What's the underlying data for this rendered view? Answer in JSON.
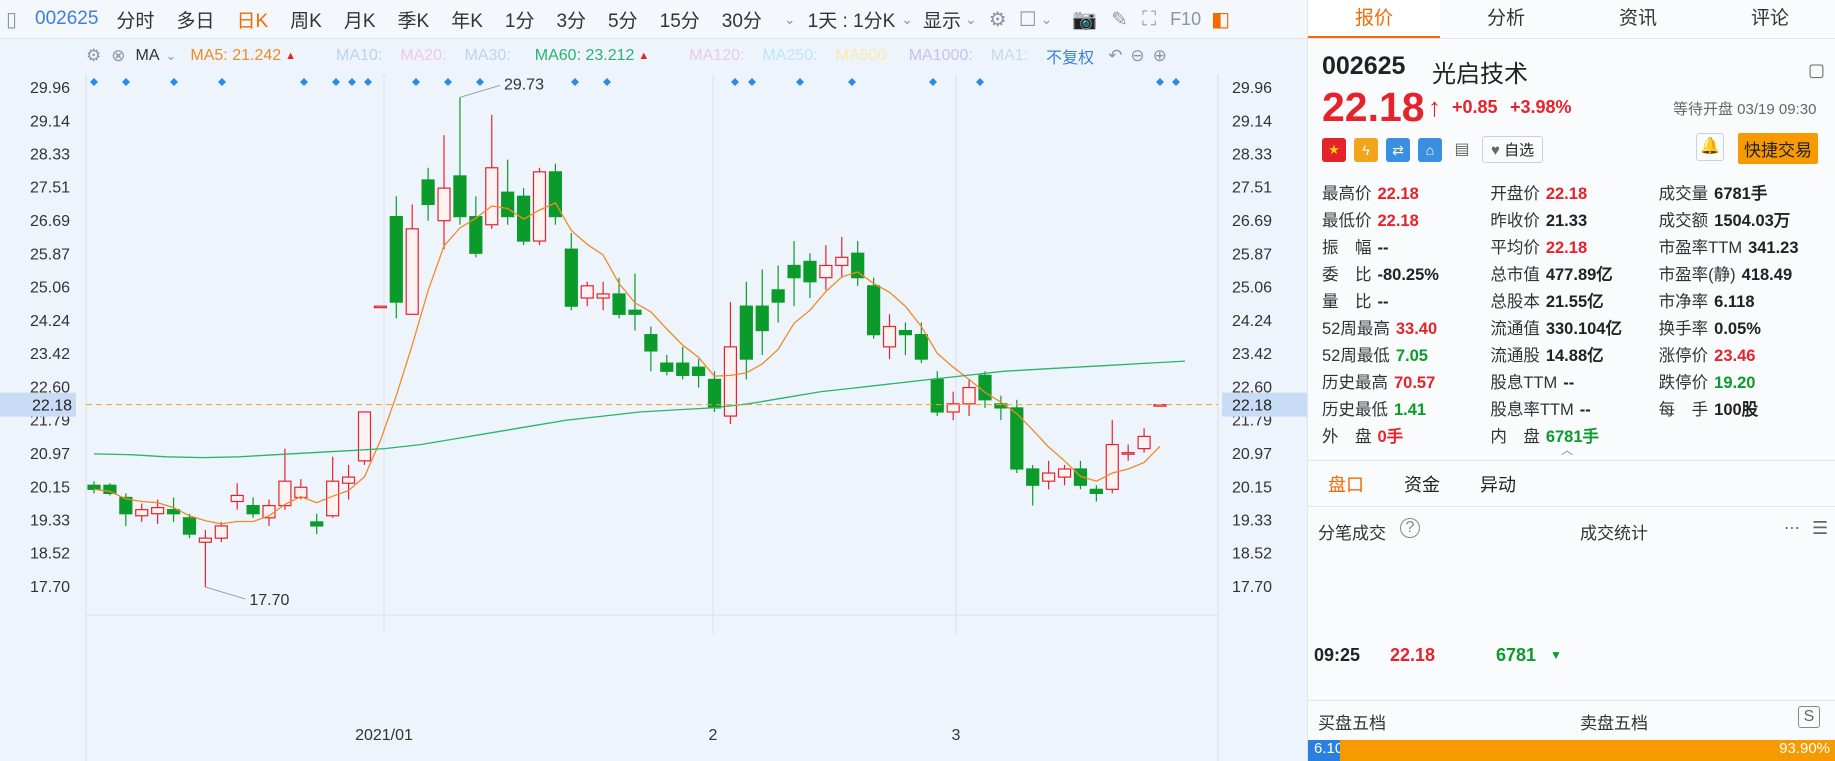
{
  "toolbar": {
    "code": "002625",
    "items": [
      "分时",
      "多日",
      "日K",
      "周K",
      "月K",
      "季K",
      "年K",
      "1分",
      "3分",
      "5分",
      "15分",
      "30分"
    ],
    "active": "日K",
    "range": "1天 : 1分K",
    "display": "显示"
  },
  "ma_bar": {
    "ma_label": "MA",
    "ma5": "MA5: 21.242",
    "ma10": "MA10:",
    "ma20": "MA20:",
    "ma30": "MA30:",
    "ma60": "MA60: 23.212",
    "ma120": "MA120:",
    "ma250": "MA250:",
    "ma500": "MA500:",
    "ma1000": "MA1000:",
    "ma1": "MA1:",
    "adjust": "不复权"
  },
  "chart": {
    "high_label": "29.73",
    "low_label": "17.70",
    "current_price_tag": "22.18",
    "x_labels": [
      "2021/01",
      "2",
      "3"
    ],
    "y_ticks": [
      "29.96",
      "29.14",
      "28.33",
      "27.51",
      "26.69",
      "25.87",
      "25.06",
      "24.24",
      "23.42",
      "22.60",
      "21.79",
      "20.97",
      "20.15",
      "19.33",
      "18.52",
      "17.70"
    ]
  },
  "chart_data": {
    "type": "bar",
    "title": "",
    "ylim": [
      17.7,
      29.96
    ],
    "candles": [
      {
        "o": 20.2,
        "c": 20.1,
        "h": 20.3,
        "l": 20.0
      },
      {
        "o": 20.2,
        "c": 20.0,
        "h": 20.25,
        "l": 19.95
      },
      {
        "o": 19.9,
        "c": 19.5,
        "h": 20.0,
        "l": 19.2
      },
      {
        "o": 19.45,
        "c": 19.6,
        "h": 19.75,
        "l": 19.3
      },
      {
        "o": 19.5,
        "c": 19.65,
        "h": 19.85,
        "l": 19.25
      },
      {
        "o": 19.6,
        "c": 19.5,
        "h": 19.9,
        "l": 19.3
      },
      {
        "o": 19.4,
        "c": 19.0,
        "h": 19.5,
        "l": 18.9
      },
      {
        "o": 18.8,
        "c": 18.9,
        "h": 19.1,
        "l": 17.7
      },
      {
        "o": 18.9,
        "c": 19.2,
        "h": 19.3,
        "l": 18.8
      },
      {
        "o": 19.8,
        "c": 19.95,
        "h": 20.25,
        "l": 19.6
      },
      {
        "o": 19.7,
        "c": 19.5,
        "h": 19.9,
        "l": 19.4
      },
      {
        "o": 19.4,
        "c": 19.7,
        "h": 19.85,
        "l": 19.2
      },
      {
        "o": 19.7,
        "c": 20.3,
        "h": 21.1,
        "l": 19.6
      },
      {
        "o": 19.9,
        "c": 20.15,
        "h": 20.35,
        "l": 19.85
      },
      {
        "o": 19.3,
        "c": 19.2,
        "h": 19.5,
        "l": 19.0
      },
      {
        "o": 19.45,
        "c": 20.3,
        "h": 20.9,
        "l": 19.4
      },
      {
        "o": 20.25,
        "c": 20.4,
        "h": 20.7,
        "l": 19.85
      },
      {
        "o": 20.8,
        "c": 22.0,
        "h": 22.0,
        "l": 20.7
      },
      {
        "o": 24.6,
        "c": 24.6,
        "h": 24.6,
        "l": 24.6
      },
      {
        "o": 26.8,
        "c": 24.7,
        "h": 27.3,
        "l": 24.3
      },
      {
        "o": 24.4,
        "c": 26.5,
        "h": 27.1,
        "l": 24.4
      },
      {
        "o": 27.7,
        "c": 27.1,
        "h": 28.0,
        "l": 26.7
      },
      {
        "o": 26.7,
        "c": 27.5,
        "h": 28.8,
        "l": 26.0
      },
      {
        "o": 27.8,
        "c": 26.8,
        "h": 29.73,
        "l": 26.6
      },
      {
        "o": 26.8,
        "c": 25.9,
        "h": 27.3,
        "l": 25.8
      },
      {
        "o": 26.6,
        "c": 28.0,
        "h": 29.3,
        "l": 26.5
      },
      {
        "o": 27.4,
        "c": 26.8,
        "h": 28.2,
        "l": 26.6
      },
      {
        "o": 27.3,
        "c": 26.2,
        "h": 27.5,
        "l": 26.1
      },
      {
        "o": 26.2,
        "c": 27.9,
        "h": 28.0,
        "l": 26.1
      },
      {
        "o": 27.9,
        "c": 26.8,
        "h": 28.1,
        "l": 26.6
      },
      {
        "o": 26.0,
        "c": 24.6,
        "h": 26.4,
        "l": 24.5
      },
      {
        "o": 24.8,
        "c": 25.1,
        "h": 25.2,
        "l": 24.6
      },
      {
        "o": 24.8,
        "c": 24.9,
        "h": 25.2,
        "l": 24.5
      },
      {
        "o": 24.9,
        "c": 24.4,
        "h": 25.3,
        "l": 24.3
      },
      {
        "o": 24.5,
        "c": 24.4,
        "h": 25.4,
        "l": 24.0
      },
      {
        "o": 23.9,
        "c": 23.5,
        "h": 24.1,
        "l": 23.0
      },
      {
        "o": 23.2,
        "c": 23.0,
        "h": 23.4,
        "l": 22.9
      },
      {
        "o": 23.2,
        "c": 22.9,
        "h": 23.6,
        "l": 22.8
      },
      {
        "o": 23.1,
        "c": 22.9,
        "h": 23.3,
        "l": 22.6
      },
      {
        "o": 22.8,
        "c": 22.1,
        "h": 23.0,
        "l": 22.0
      },
      {
        "o": 21.9,
        "c": 23.6,
        "h": 24.7,
        "l": 21.7
      },
      {
        "o": 24.6,
        "c": 23.3,
        "h": 25.2,
        "l": 22.8
      },
      {
        "o": 24.6,
        "c": 24.0,
        "h": 25.5,
        "l": 23.4
      },
      {
        "o": 25.0,
        "c": 24.7,
        "h": 25.6,
        "l": 24.2
      },
      {
        "o": 25.6,
        "c": 25.3,
        "h": 26.2,
        "l": 24.6
      },
      {
        "o": 25.7,
        "c": 25.2,
        "h": 25.9,
        "l": 24.8
      },
      {
        "o": 25.3,
        "c": 25.6,
        "h": 26.1,
        "l": 25.0
      },
      {
        "o": 25.6,
        "c": 25.8,
        "h": 26.3,
        "l": 25.3
      },
      {
        "o": 25.9,
        "c": 25.3,
        "h": 26.2,
        "l": 25.1
      },
      {
        "o": 25.1,
        "c": 23.9,
        "h": 25.3,
        "l": 23.8
      },
      {
        "o": 23.6,
        "c": 24.1,
        "h": 24.4,
        "l": 23.3
      },
      {
        "o": 24.0,
        "c": 23.9,
        "h": 24.2,
        "l": 23.4
      },
      {
        "o": 23.9,
        "c": 23.3,
        "h": 24.2,
        "l": 23.2
      },
      {
        "o": 22.8,
        "c": 22.0,
        "h": 23.0,
        "l": 21.9
      },
      {
        "o": 22.0,
        "c": 22.2,
        "h": 22.5,
        "l": 21.8
      },
      {
        "o": 22.2,
        "c": 22.6,
        "h": 22.8,
        "l": 21.9
      },
      {
        "o": 22.9,
        "c": 22.3,
        "h": 23.0,
        "l": 22.1
      },
      {
        "o": 22.2,
        "c": 22.1,
        "h": 22.4,
        "l": 21.8
      },
      {
        "o": 22.1,
        "c": 20.6,
        "h": 22.3,
        "l": 20.5
      },
      {
        "o": 20.6,
        "c": 20.2,
        "h": 20.7,
        "l": 19.7
      },
      {
        "o": 20.3,
        "c": 20.5,
        "h": 20.8,
        "l": 20.1
      },
      {
        "o": 20.4,
        "c": 20.6,
        "h": 20.7,
        "l": 20.2
      },
      {
        "o": 20.6,
        "c": 20.2,
        "h": 20.8,
        "l": 20.1
      },
      {
        "o": 20.1,
        "c": 20.0,
        "h": 20.2,
        "l": 19.8
      },
      {
        "o": 20.1,
        "c": 21.2,
        "h": 21.8,
        "l": 20.0
      },
      {
        "o": 21.0,
        "c": 21.0,
        "h": 21.2,
        "l": 20.8
      },
      {
        "o": 21.1,
        "c": 21.4,
        "h": 21.6,
        "l": 21.0
      },
      {
        "o": 22.18,
        "c": 22.18,
        "h": 22.18,
        "l": 22.18
      }
    ]
  },
  "stock": {
    "code": "002625",
    "name": "光启技术",
    "price": "22.18",
    "change": "+0.85",
    "pct": "+3.98%",
    "status": "等待开盘 03/19 09:30",
    "watchlist": "自选",
    "quick_trade": "快捷交易"
  },
  "quote_rows": [
    [
      [
        "最高价",
        "22.18",
        "red"
      ],
      [
        "开盘价",
        "22.18",
        "red"
      ],
      [
        "成交量",
        "6781手",
        ""
      ]
    ],
    [
      [
        "最低价",
        "22.18",
        "red"
      ],
      [
        "昨收价",
        "21.33",
        ""
      ],
      [
        "成交额",
        "1504.03万",
        ""
      ]
    ],
    [
      [
        "振　幅",
        "--",
        ""
      ],
      [
        "平均价",
        "22.18",
        "red"
      ],
      [
        "市盈率TTM",
        "341.23",
        ""
      ]
    ],
    [
      [
        "委　比",
        "-80.25%",
        ""
      ],
      [
        "总市值",
        "477.89亿",
        ""
      ],
      [
        "市盈率(静)",
        "418.49",
        ""
      ]
    ],
    [
      [
        "量　比",
        "--",
        ""
      ],
      [
        "总股本",
        "21.55亿",
        ""
      ],
      [
        "市净率",
        "6.118",
        ""
      ]
    ],
    [
      [
        "52周最高",
        "33.40",
        "red"
      ],
      [
        "流通值",
        "330.104亿",
        ""
      ],
      [
        "换手率",
        "0.05%",
        ""
      ]
    ],
    [
      [
        "52周最低",
        "7.05",
        "green"
      ],
      [
        "流通股",
        "14.88亿",
        ""
      ],
      [
        "涨停价",
        "23.46",
        "red"
      ]
    ],
    [
      [
        "历史最高",
        "70.57",
        "red"
      ],
      [
        "股息TTM",
        "--",
        ""
      ],
      [
        "跌停价",
        "19.20",
        "green"
      ]
    ],
    [
      [
        "历史最低",
        "1.41",
        "green"
      ],
      [
        "股息率TTM",
        "--",
        ""
      ],
      [
        "每　手",
        "100股",
        ""
      ]
    ],
    [
      [
        "外　盘",
        "0手",
        "red"
      ],
      [
        "内　盘",
        "6781手",
        "green"
      ],
      [
        "",
        "",
        " "
      ]
    ]
  ],
  "right_tabs": [
    "报价",
    "分析",
    "资讯",
    "评论"
  ],
  "sub_tabs": [
    "盘口",
    "资金",
    "异动"
  ],
  "ticks": {
    "title": "分笔成交",
    "stats": "成交统计",
    "row": {
      "time": "09:25",
      "price": "22.18",
      "vol": "6781"
    }
  },
  "order_book": {
    "buy": "买盘五档",
    "sell": "卖盘五档",
    "buy_pct": "6.10%",
    "sell_pct": "93.90%"
  },
  "colors": {
    "up": "#e5232c",
    "down": "#0a9b2a",
    "accent": "#f26a00",
    "ma5": "#f08a28",
    "ma60": "#2ab36e"
  }
}
